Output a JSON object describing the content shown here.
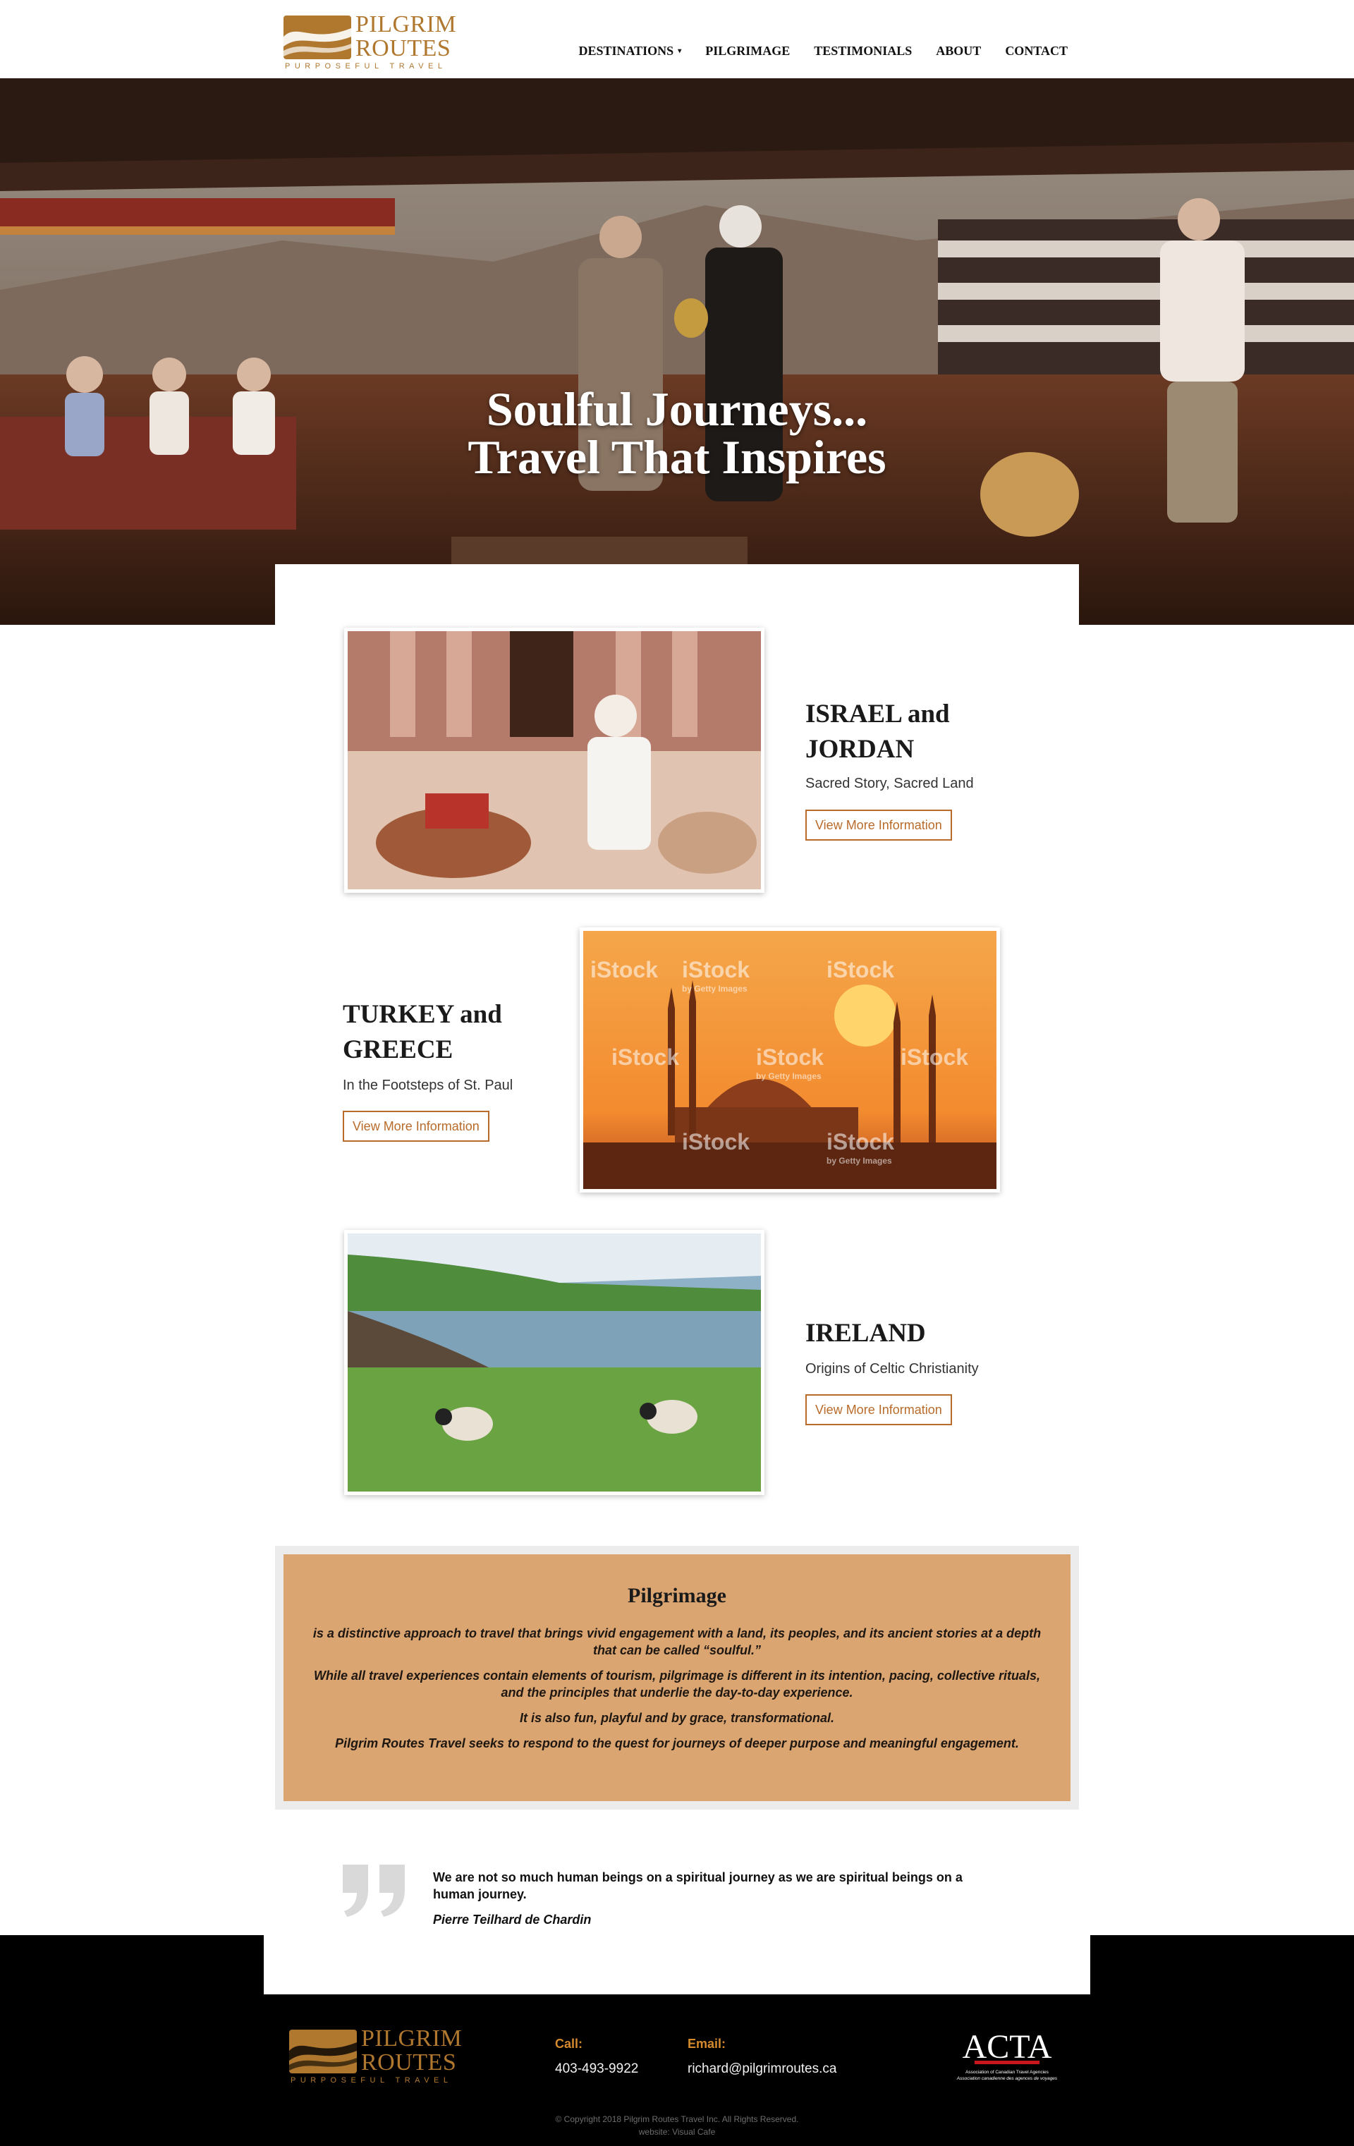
{
  "brand": {
    "name_line1": "PILGRIM",
    "name_line2": "ROUTES",
    "tagline": "PURPOSEFUL TRAVEL"
  },
  "nav": {
    "items": [
      {
        "label": "DESTINATIONS",
        "has_dropdown": true
      },
      {
        "label": "PILGRIMAGE"
      },
      {
        "label": "TESTIMONIALS"
      },
      {
        "label": "ABOUT"
      },
      {
        "label": "CONTACT"
      }
    ]
  },
  "hero": {
    "line1": "Soulful Journeys...",
    "line2": "Travel That Inspires"
  },
  "destinations": [
    {
      "title_line1": "ISRAEL and",
      "title_line2": "JORDAN",
      "subtitle": "Sacred Story, Sacred Land",
      "button": "View More Information"
    },
    {
      "title_line1": "TURKEY and",
      "title_line2": "GREECE",
      "subtitle": "In the Footsteps of St. Paul",
      "button": "View More Information",
      "watermark": "iStock",
      "watermark_sub": "by Getty Images"
    },
    {
      "title_line1": "IRELAND",
      "title_line2": "",
      "subtitle": "Origins of Celtic Christianity",
      "button": "View More Information"
    }
  ],
  "pilgrimage": {
    "title": "Pilgrimage",
    "paragraphs": [
      "is a distinctive approach to travel that brings vivid engagement with a land, its peoples, and its ancient stories at a depth that can be called “soulful.”",
      "While all travel experiences contain elements of tourism, pilgrimage is different in its intention, pacing, collective rituals, and the principles that underlie the day-to-day experience.",
      "It is also fun, playful and by grace, transformational.",
      "Pilgrim Routes Travel seeks to respond to the quest for journeys of deeper purpose and meaningful engagement."
    ]
  },
  "quote": {
    "text": "We are not so much human beings on a spiritual journey as we are spiritual beings on a human journey.",
    "author": "Pierre Teilhard de Chardin"
  },
  "footer": {
    "call_label": "Call:",
    "call_value": "403-493-9922",
    "email_label": "Email:",
    "email_value": "richard@pilgrimroutes.ca",
    "agta_logo_text": "ACTA",
    "agta_sub1": "Association of Canadian Travel Agencies",
    "agta_sub2": "Association canadienne des agences de voyages",
    "copyright": "© Copyright 2018 Pilgrim Routes Travel Inc. All Rights Reserved.",
    "credit": "website: Visual Cafe"
  },
  "colors": {
    "accent": "#b86b2a",
    "brand_gold": "#b0782f",
    "pilgrimage_bg": "#dba571",
    "footer_bg": "#000000",
    "footer_label": "#d48a2c"
  },
  "icons": {
    "quote": "quote-mark-icon",
    "dropdown": "chevron-down-icon"
  }
}
